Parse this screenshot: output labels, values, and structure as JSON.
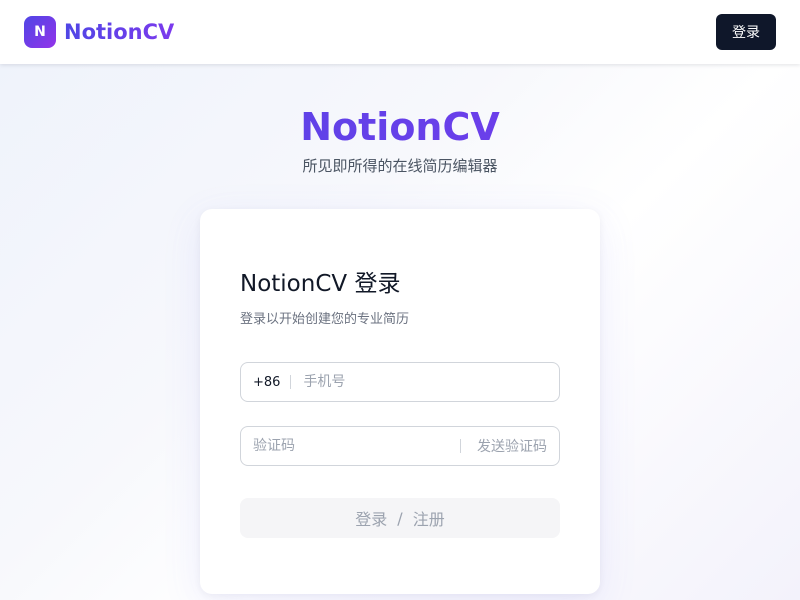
{
  "header": {
    "logo_letter": "N",
    "brand": "NotionCV",
    "login_label": "登录"
  },
  "hero": {
    "title": "NotionCV",
    "subtitle": "所见即所得的在线简历编辑器"
  },
  "card": {
    "title": "NotionCV 登录",
    "subtitle": "登录以开始创建您的专业简历",
    "phone": {
      "prefix": "+86",
      "placeholder": "手机号",
      "value": ""
    },
    "code": {
      "placeholder": "验证码",
      "value": "",
      "send_label": "发送验证码"
    },
    "submit": {
      "login": "登录",
      "separator": "/",
      "register": "注册"
    }
  },
  "colors": {
    "brand_start": "#4f46e5",
    "brand_end": "#7c3aed",
    "dark_button": "#0f172a",
    "disabled_text": "#9ca3af"
  },
  "icons": {
    "logo": "n-letter-logo-icon"
  }
}
